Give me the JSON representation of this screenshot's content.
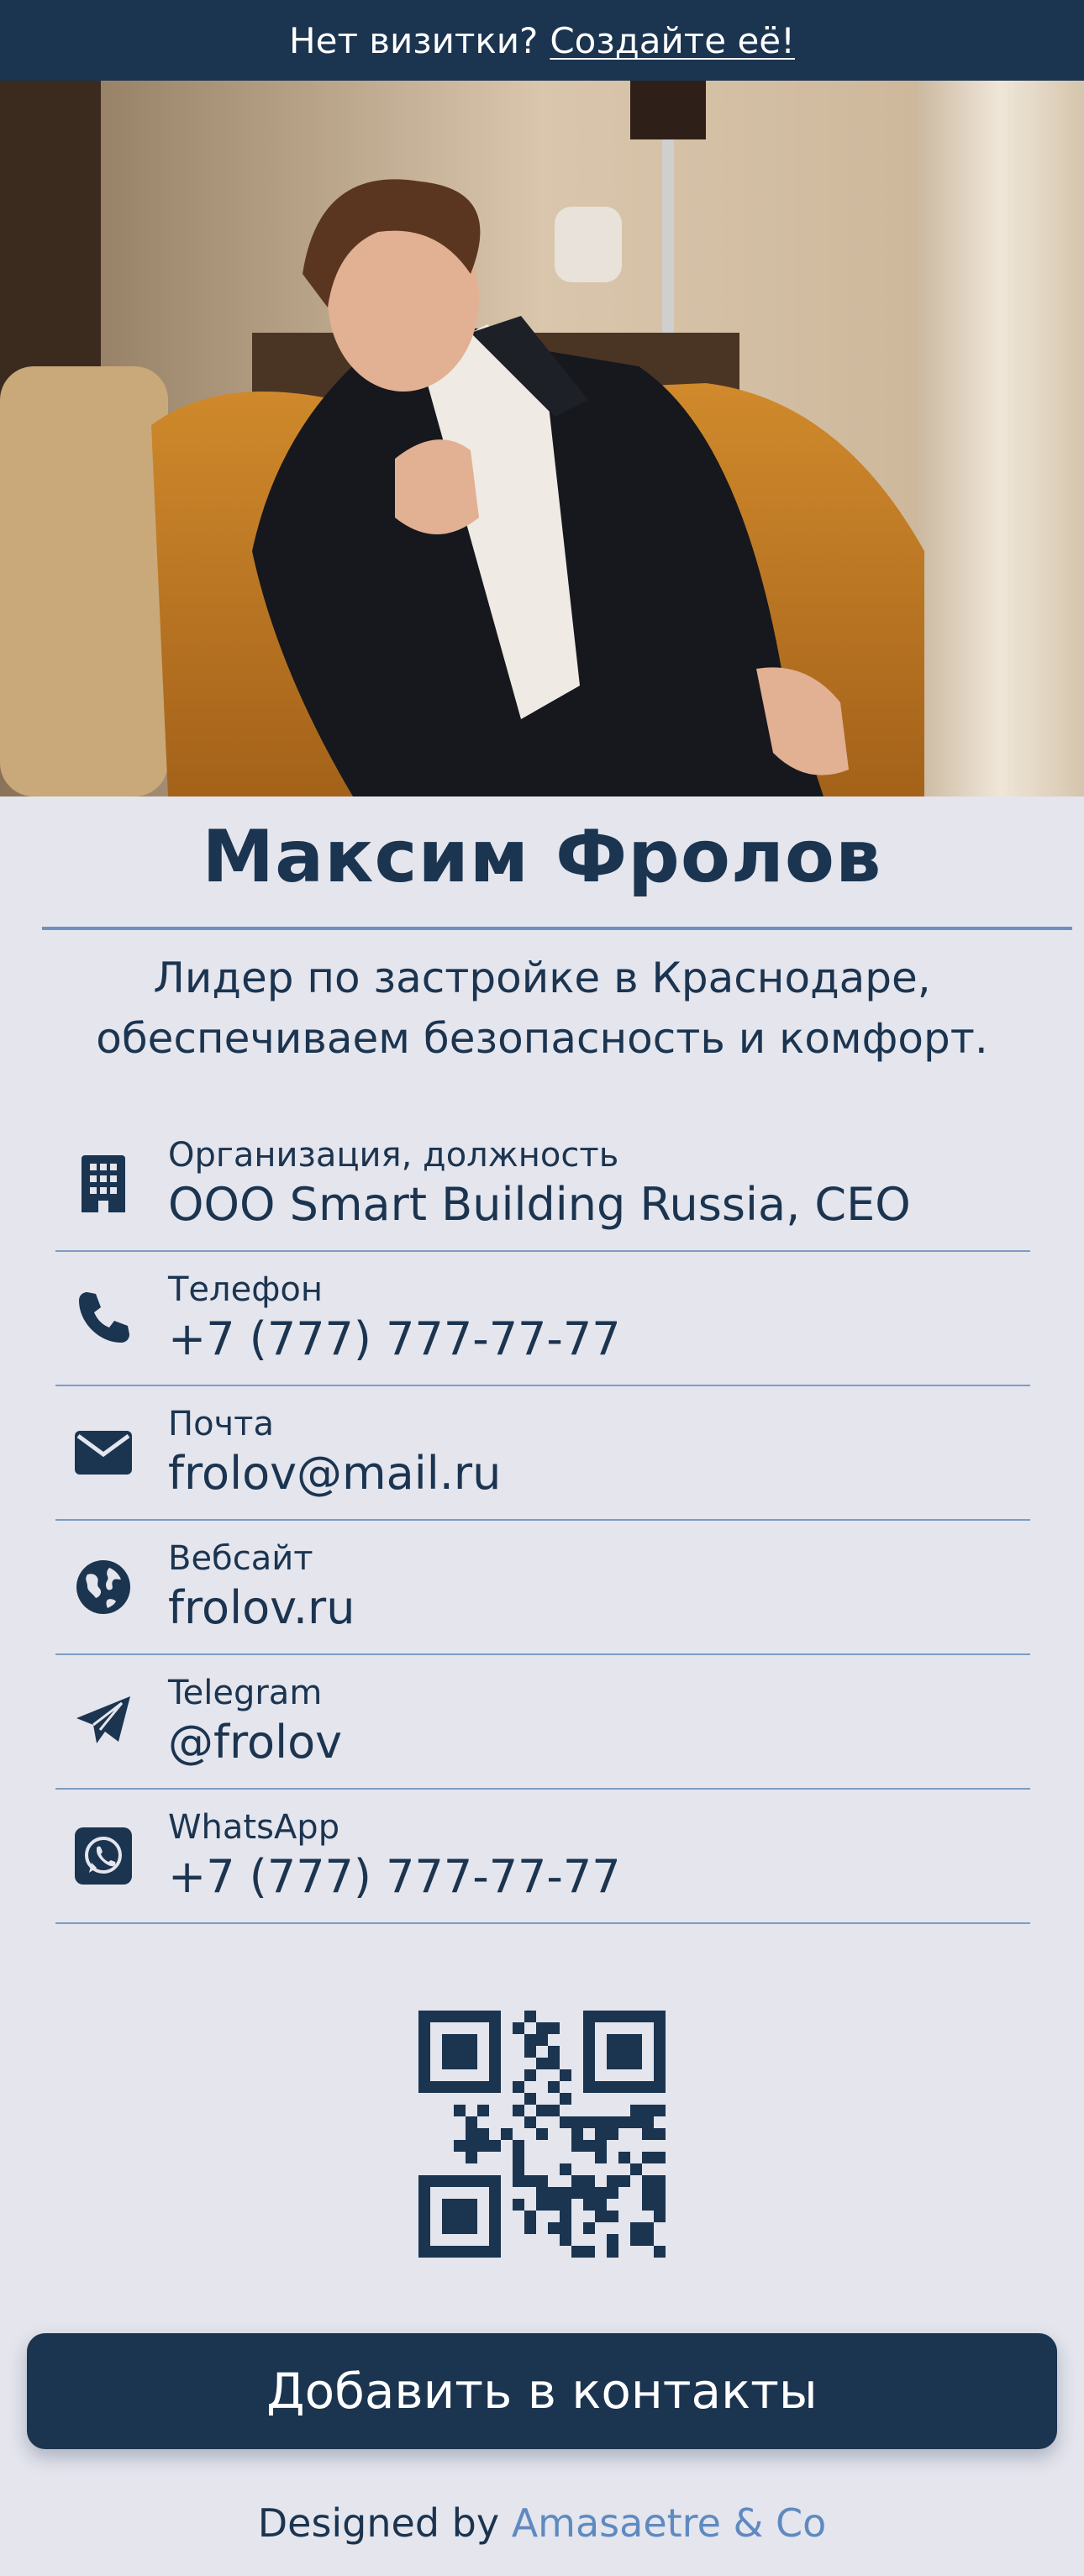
{
  "topbar": {
    "question": "Нет визитки?",
    "link": "Создайте её!"
  },
  "profile": {
    "name": "Максим Фролов",
    "tagline": "Лидер по застройке в Краснодаре, обеспечиваем безопасность и комфорт."
  },
  "contacts": [
    {
      "icon": "building-icon",
      "label": "Организация, должность",
      "value": "ООО Smart Building Russia, CEO"
    },
    {
      "icon": "phone-icon",
      "label": "Телефон",
      "value": "+7 (777) 777-77-77"
    },
    {
      "icon": "envelope-icon",
      "label": "Почта",
      "value": "frolov@mail.ru"
    },
    {
      "icon": "globe-icon",
      "label": "Вебсайт",
      "value": "frolov.ru"
    },
    {
      "icon": "telegram-icon",
      "label": "Telegram",
      "value": "@frolov"
    },
    {
      "icon": "whatsapp-icon",
      "label": "WhatsApp",
      "value": "+7 (777) 777-77-77"
    }
  ],
  "actions": {
    "add_contact": "Добавить в контакты"
  },
  "footer": {
    "prefix": "Designed by",
    "brand": "Amasaetre & Co"
  },
  "colors": {
    "primary": "#1b3450",
    "accent": "#6b92be",
    "background": "#e4e5ed",
    "brand_link": "#5f8ac0"
  }
}
